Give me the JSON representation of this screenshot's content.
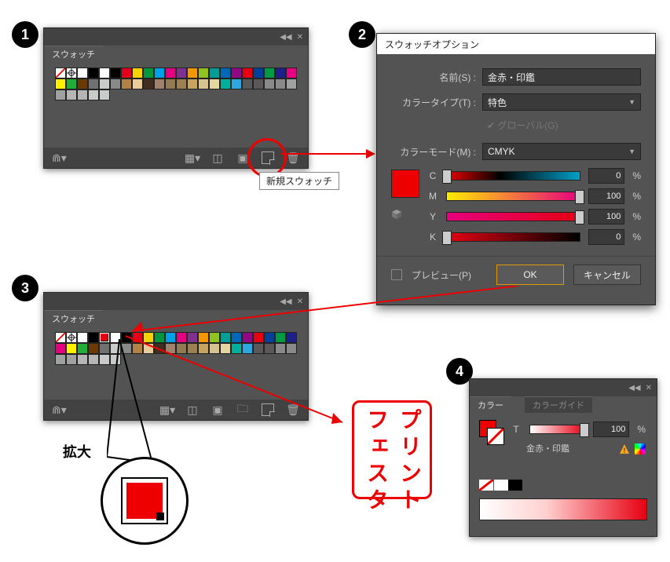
{
  "steps": {
    "s1": "1",
    "s2": "2",
    "s3": "3",
    "s4": "4"
  },
  "swatches_panel": {
    "tab_label": "スウォッチ",
    "tooltip_new_swatch": "新規スウォッチ"
  },
  "dialog": {
    "title": "スウォッチオプション",
    "name_label": "名前(S) :",
    "name_value": "金赤・印鑑",
    "color_type_label": "カラータイプ(T) :",
    "color_type_value": "特色",
    "global_label": "グローバル(G)",
    "color_mode_label": "カラーモード(M) :",
    "color_mode_value": "CMYK",
    "channels": {
      "C": {
        "label": "C",
        "value": "0",
        "pct": "%"
      },
      "M": {
        "label": "M",
        "value": "100",
        "pct": "%"
      },
      "Y": {
        "label": "Y",
        "value": "100",
        "pct": "%"
      },
      "K": {
        "label": "K",
        "value": "0",
        "pct": "%"
      }
    },
    "preview_label": "プレビュー(P)",
    "ok_label": "OK",
    "cancel_label": "キャンセル"
  },
  "zoom": {
    "label": "拡大"
  },
  "color_panel": {
    "tab1": "カラー",
    "tab2": "カラーガイド",
    "tint_label": "T",
    "tint_value": "100",
    "tint_pct": "%",
    "swatch_name": "金赤・印鑑"
  },
  "swatch_colors_row1": [
    "#ffffff",
    "#000000",
    "#e2001a",
    "#f5d300",
    "#00963f",
    "#00a0e9",
    "#e4007f",
    "#7e318e",
    "#f39800",
    "#8fc31f",
    "#009e96",
    "#0068b7",
    "#920783",
    "#e60012",
    "#004098",
    "#009944",
    "#1d2088",
    "#e4007f",
    "#fff100",
    "#22ac38"
  ],
  "swatch_colors_row2": [
    "#6a3906",
    "#727171",
    "#c9caca",
    "#898989",
    "#b28146",
    "#eacb9a",
    "#432d1e",
    "#a0816c",
    "#917b53",
    "#9b8052",
    "#c6a35f",
    "#d6c490",
    "#e4d5a3",
    "#00ae9c",
    "#2ea7e0"
  ],
  "swatch_colors_row3": [
    "#595757",
    "#595757",
    "#898989",
    "#898989",
    "#9fa0a0",
    "#9fa0a0",
    "#b5b5b6",
    "#b5b5b6",
    "#c9caca",
    "#c9caca"
  ]
}
